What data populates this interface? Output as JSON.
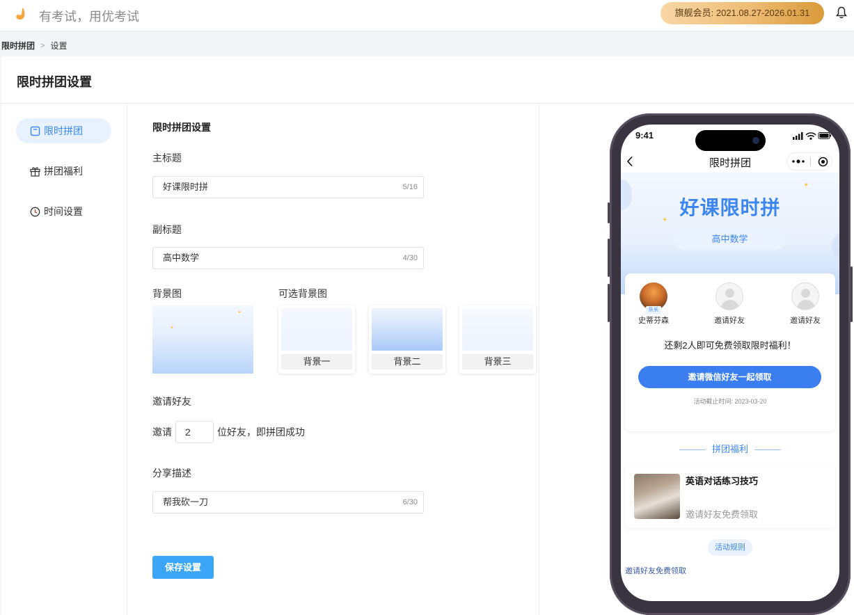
{
  "header": {
    "slogan": "有考试，用优考试",
    "vip_badge": "旗舰会员: 2021.08.27-2026.01.31"
  },
  "breadcrumb": {
    "items": [
      "限时拼团",
      "设置"
    ]
  },
  "page": {
    "title": "限时拼团设置"
  },
  "sidebar": {
    "items": [
      {
        "label": "限时拼团",
        "icon": "calendar-icon",
        "active": true
      },
      {
        "label": "拼团福利",
        "icon": "gift-icon",
        "active": false
      },
      {
        "label": "时间设置",
        "icon": "clock-icon",
        "active": false
      }
    ]
  },
  "form": {
    "section_title": "限时拼团设置",
    "main_title": {
      "label": "主标题",
      "value": "好课限时拼",
      "count": "5/16"
    },
    "sub_title": {
      "label": "副标题",
      "value": "高中数学",
      "count": "4/30"
    },
    "background": {
      "label": "背景图",
      "options_label": "可选背景图",
      "options": [
        "背景一",
        "背景二",
        "背景三"
      ]
    },
    "invite": {
      "label": "邀请好友",
      "prefix": "邀请",
      "value": "2",
      "suffix": "位好友，即拼团成功"
    },
    "share": {
      "label": "分享描述",
      "value": "帮我砍一刀",
      "count": "6/30"
    },
    "save_label": "保存设置"
  },
  "phone": {
    "time": "9:41",
    "nav_title": "限时拼团",
    "hero_title": "好课限时拼",
    "hero_sub": "高中数学",
    "members": [
      {
        "name": "史蒂芬森",
        "tag": "队长"
      },
      {
        "name": "邀请好友"
      },
      {
        "name": "邀请好友"
      }
    ],
    "remain_text": "还剩2人即可免费领取限时福利！",
    "cta_label": "邀请微信好友一起领取",
    "deadline": "活动截止时间: 2023-03-20",
    "benefit_title": "拼团福利",
    "course_title": "英语对话练习技巧",
    "course_sub": "邀请好友免费领取",
    "rules_label": "活动规则",
    "footer_text": "邀请好友免费领取"
  },
  "colors": {
    "primary": "#3a86f5",
    "save_button": "#3aa6f5",
    "vip_gold": "#eebc74"
  }
}
